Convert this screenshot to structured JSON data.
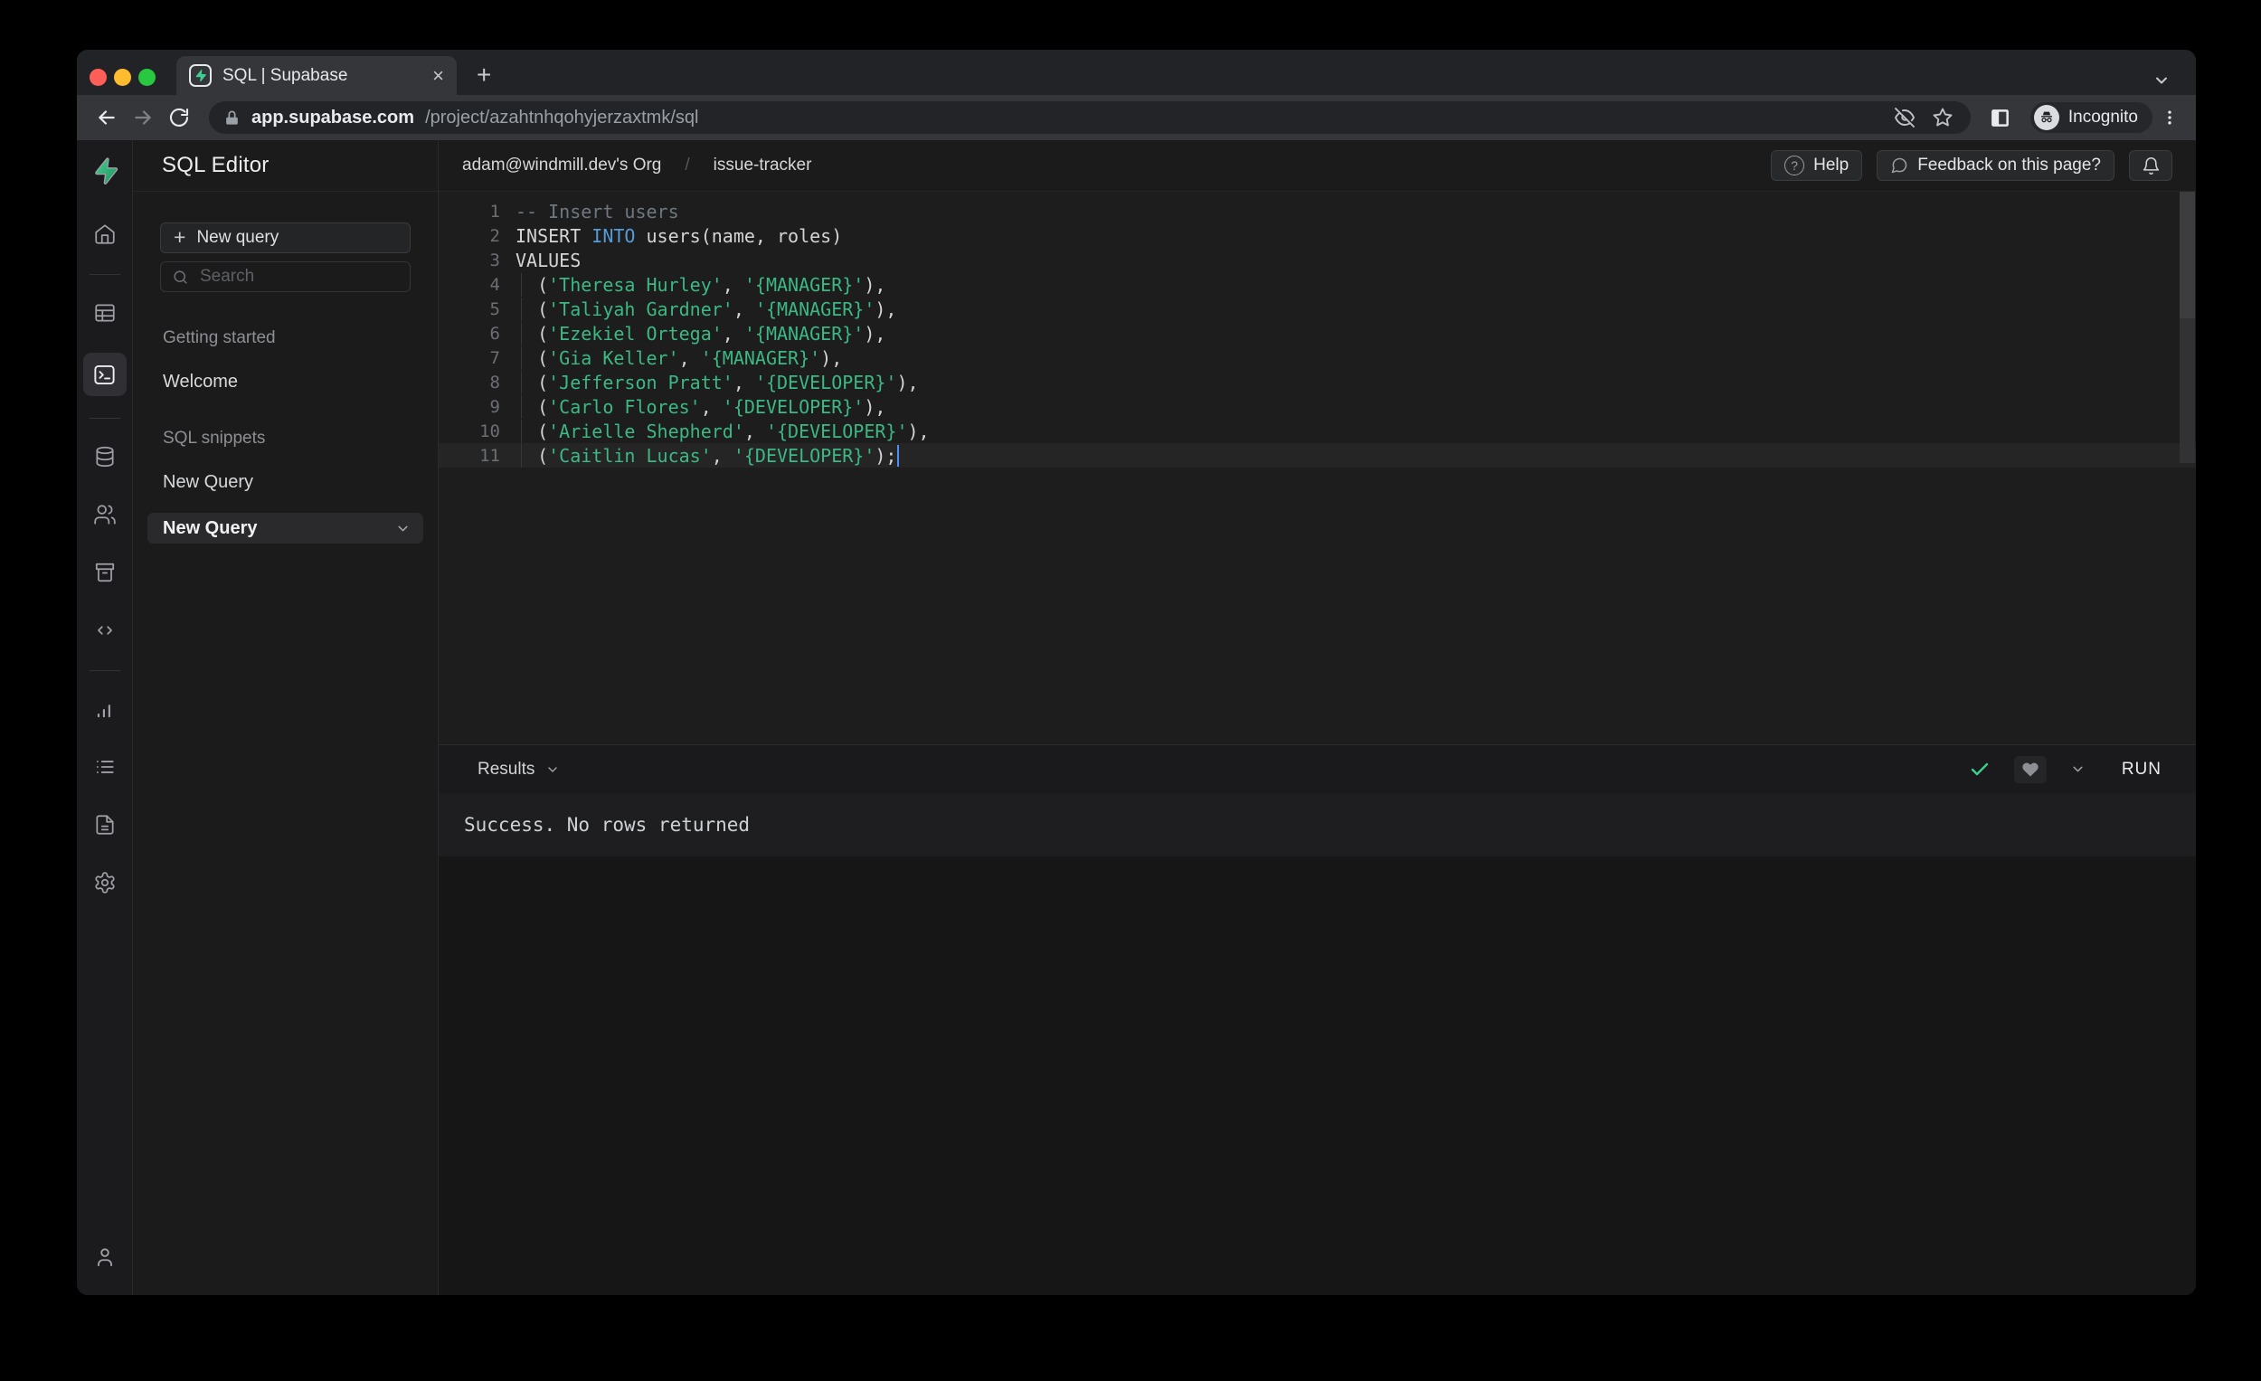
{
  "browser": {
    "tab_title": "SQL | Supabase",
    "close_tab": "×",
    "new_tab": "+",
    "url_host": "app.supabase.com",
    "url_path": "/project/azahtnhqohyjerzaxtmk/sql",
    "incognito_label": "Incognito"
  },
  "sidebar_rail": {
    "items": [
      "supabase-logo",
      "home",
      "table-editor",
      "sql-editor",
      "database",
      "authentication",
      "storage",
      "edge-functions",
      "reports",
      "logs",
      "api-docs",
      "settings",
      "account"
    ],
    "active": "sql-editor"
  },
  "snippets_panel": {
    "title": "SQL Editor",
    "new_query_button": "New query",
    "plus": "+",
    "search_placeholder": "Search",
    "sections": [
      {
        "label": "Getting started",
        "items": [
          {
            "label": "Welcome"
          }
        ]
      },
      {
        "label": "SQL snippets",
        "items": [
          {
            "label": "New Query"
          },
          {
            "label": "New Query",
            "selected": true
          }
        ]
      }
    ]
  },
  "header": {
    "breadcrumb": [
      "adam@windmill.dev's Org",
      "issue-tracker"
    ],
    "breadcrumb_separator": "/",
    "help_button": "Help",
    "help_glyph": "?",
    "feedback_button": "Feedback on this page?"
  },
  "editor": {
    "lines": [
      {
        "n": "1",
        "segs": [
          {
            "c": "cm",
            "t": "-- Insert users"
          }
        ]
      },
      {
        "n": "2",
        "segs": [
          {
            "c": "pl",
            "t": "INSERT "
          },
          {
            "c": "kw",
            "t": "INTO"
          },
          {
            "c": "pl",
            "t": " users(name, roles)"
          }
        ]
      },
      {
        "n": "3",
        "segs": [
          {
            "c": "pl",
            "t": "VALUES"
          }
        ]
      },
      {
        "n": "4",
        "guide": true,
        "segs": [
          {
            "c": "pl",
            "t": "  ("
          },
          {
            "c": "str",
            "t": "'Theresa Hurley'"
          },
          {
            "c": "pl",
            "t": ", "
          },
          {
            "c": "str",
            "t": "'{MANAGER}'"
          },
          {
            "c": "pl",
            "t": "),"
          }
        ]
      },
      {
        "n": "5",
        "guide": true,
        "segs": [
          {
            "c": "pl",
            "t": "  ("
          },
          {
            "c": "str",
            "t": "'Taliyah Gardner'"
          },
          {
            "c": "pl",
            "t": ", "
          },
          {
            "c": "str",
            "t": "'{MANAGER}'"
          },
          {
            "c": "pl",
            "t": "),"
          }
        ]
      },
      {
        "n": "6",
        "guide": true,
        "segs": [
          {
            "c": "pl",
            "t": "  ("
          },
          {
            "c": "str",
            "t": "'Ezekiel Ortega'"
          },
          {
            "c": "pl",
            "t": ", "
          },
          {
            "c": "str",
            "t": "'{MANAGER}'"
          },
          {
            "c": "pl",
            "t": "),"
          }
        ]
      },
      {
        "n": "7",
        "guide": true,
        "segs": [
          {
            "c": "pl",
            "t": "  ("
          },
          {
            "c": "str",
            "t": "'Gia Keller'"
          },
          {
            "c": "pl",
            "t": ", "
          },
          {
            "c": "str",
            "t": "'{MANAGER}'"
          },
          {
            "c": "pl",
            "t": "),"
          }
        ]
      },
      {
        "n": "8",
        "guide": true,
        "segs": [
          {
            "c": "pl",
            "t": "  ("
          },
          {
            "c": "str",
            "t": "'Jefferson Pratt'"
          },
          {
            "c": "pl",
            "t": ", "
          },
          {
            "c": "str",
            "t": "'{DEVELOPER}'"
          },
          {
            "c": "pl",
            "t": "),"
          }
        ]
      },
      {
        "n": "9",
        "guide": true,
        "segs": [
          {
            "c": "pl",
            "t": "  ("
          },
          {
            "c": "str",
            "t": "'Carlo Flores'"
          },
          {
            "c": "pl",
            "t": ", "
          },
          {
            "c": "str",
            "t": "'{DEVELOPER}'"
          },
          {
            "c": "pl",
            "t": "),"
          }
        ]
      },
      {
        "n": "10",
        "guide": true,
        "segs": [
          {
            "c": "pl",
            "t": "  ("
          },
          {
            "c": "str",
            "t": "'Arielle Shepherd'"
          },
          {
            "c": "pl",
            "t": ", "
          },
          {
            "c": "str",
            "t": "'{DEVELOPER}'"
          },
          {
            "c": "pl",
            "t": "),"
          }
        ]
      },
      {
        "n": "11",
        "guide": true,
        "current": true,
        "cursor": true,
        "segs": [
          {
            "c": "pl",
            "t": "  ("
          },
          {
            "c": "str",
            "t": "'Caitlin Lucas'"
          },
          {
            "c": "pl",
            "t": ", "
          },
          {
            "c": "str",
            "t": "'{DEVELOPER}'"
          },
          {
            "c": "pl",
            "t": ");"
          }
        ]
      }
    ]
  },
  "results": {
    "toolbar_label": "Results",
    "run_button": "RUN",
    "message": "Success. No rows returned"
  },
  "colors": {
    "brand_green": "#3ecf8e",
    "keyword_blue": "#569cd6",
    "string_green": "#3cb884",
    "success_check": "#3ecf8e",
    "toolbar_grey": "#35363a",
    "editor_bg": "#1d1d1e",
    "cursor_blue": "#4e8ef7"
  }
}
